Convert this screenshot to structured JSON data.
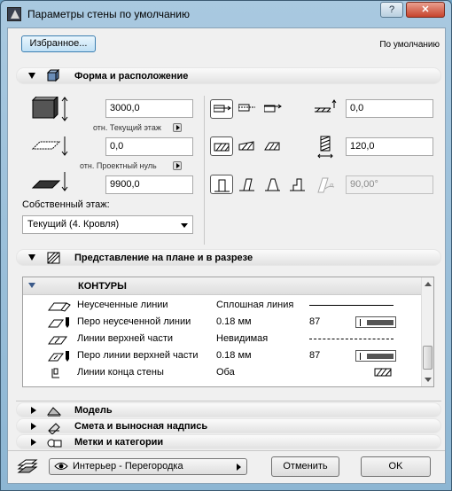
{
  "window": {
    "title": "Параметры стены по умолчанию",
    "help_label": "?",
    "close_label": "✕"
  },
  "top": {
    "favorites_button": "Избранное...",
    "default_label": "По умолчанию"
  },
  "shape_section": {
    "title": "Форма и расположение",
    "height_value": "3000,0",
    "height_ref_label": "отн. Текущий этаж",
    "offset_value": "0,0",
    "offset_ref_label": "отн. Проектный нуль",
    "elevation_value": "9900,0",
    "home_story_label": "Собственный этаж:",
    "home_story_value": "Текущий (4. Кровля)",
    "ref_offset_value": "0,0",
    "thickness_value": "120,0",
    "angle_value": "90,00°"
  },
  "plan_section": {
    "title": "Представление на плане и в разрезе",
    "group_label": "КОНТУРЫ",
    "rows": [
      {
        "name": "Неусеченные линии",
        "value": "Сплошная линия",
        "num": ""
      },
      {
        "name": "Перо неусеченной линии",
        "value": "0.18 мм",
        "num": "87"
      },
      {
        "name": "Линии верхней части",
        "value": "Невидимая",
        "num": ""
      },
      {
        "name": "Перо линии верхней части",
        "value": "0.18 мм",
        "num": "87"
      },
      {
        "name": "Линии конца стены",
        "value": "Оба",
        "num": ""
      }
    ]
  },
  "collapsed_sections": [
    {
      "title": "Модель"
    },
    {
      "title": "Смета и выносная надпись"
    },
    {
      "title": "Метки и категории"
    }
  ],
  "bottom": {
    "favorite_set": "Интерьер - Перегородка",
    "cancel_label": "Отменить",
    "ok_label": "OK"
  }
}
